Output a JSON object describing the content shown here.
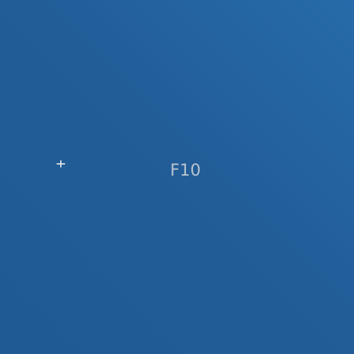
{
  "screen": {
    "key_label": "F10",
    "cursor_icon": "crosshair-cursor-icon",
    "colors": {
      "background_start": "#266ba9",
      "background_end": "#205a94",
      "label_text": "#b9c3cf",
      "cursor": "#d8dde5"
    }
  }
}
